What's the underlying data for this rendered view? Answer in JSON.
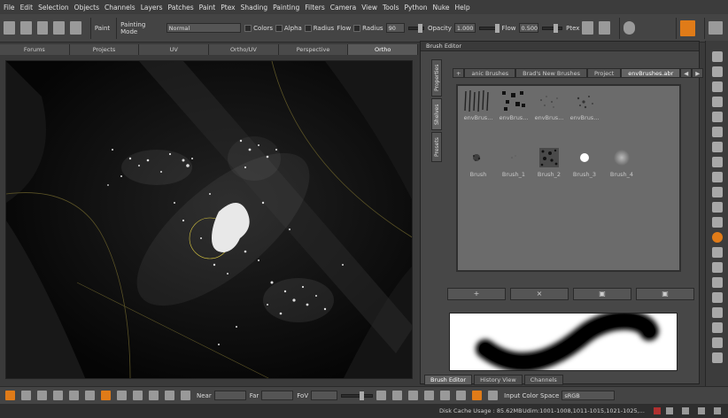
{
  "menu": [
    "File",
    "Edit",
    "Selection",
    "Objects",
    "Channels",
    "Layers",
    "Patches",
    "Paint",
    "Ptex",
    "Shading",
    "Painting",
    "Filters",
    "Camera",
    "View",
    "Tools",
    "Python",
    "Nuke",
    "Help"
  ],
  "toolbar": {
    "paint_label": "Paint",
    "painting_mode_label": "Painting Mode",
    "painting_mode_value": "Normal",
    "colors_label": "Colors",
    "alpha_label": "Alpha",
    "radius_label": "Radius",
    "flow_label": "Flow",
    "radius2_label": "Radius",
    "radius2_value": "90",
    "opacity_label": "Opacity",
    "opacity_value": "1.000",
    "flow2_label": "Flow",
    "flow2_value": "0.500",
    "ptex_label": "Ptex"
  },
  "viewport_tabs": [
    "Forums",
    "Projects",
    "UV",
    "Ortho/UV",
    "Perspective",
    "Ortho"
  ],
  "viewport_active_tab": "Ortho",
  "brush_editor": {
    "title": "Brush Editor",
    "side_tabs": [
      "Properties",
      "Shelves",
      "Presets"
    ],
    "shelf_tabs": [
      "anic Brushes",
      "Brad's New Brushes",
      "Project",
      "envBrushes.abr"
    ],
    "shelf_top_labels": [
      "envBrus...",
      "envBrus...",
      "envBrus...",
      "envBrus..."
    ],
    "brushes": [
      "Brush",
      "Brush_1",
      "Brush_2",
      "Brush_3",
      "Brush_4"
    ],
    "buttons": [
      "+",
      "×",
      "▣",
      "▣"
    ],
    "bottom_tabs": [
      "Brush Editor",
      "History View",
      "Channels"
    ]
  },
  "bottom": {
    "near_label": "Near",
    "far_label": "Far",
    "fov_label": "FoV",
    "input_color_space_label": "Input Color Space",
    "input_color_space_value": "sRGB"
  },
  "status": {
    "disk_cache": "Disk Cache Usage : 85.62MB",
    "udim": "Udim:1001-1008,1011-1015,1021-1025,..."
  }
}
